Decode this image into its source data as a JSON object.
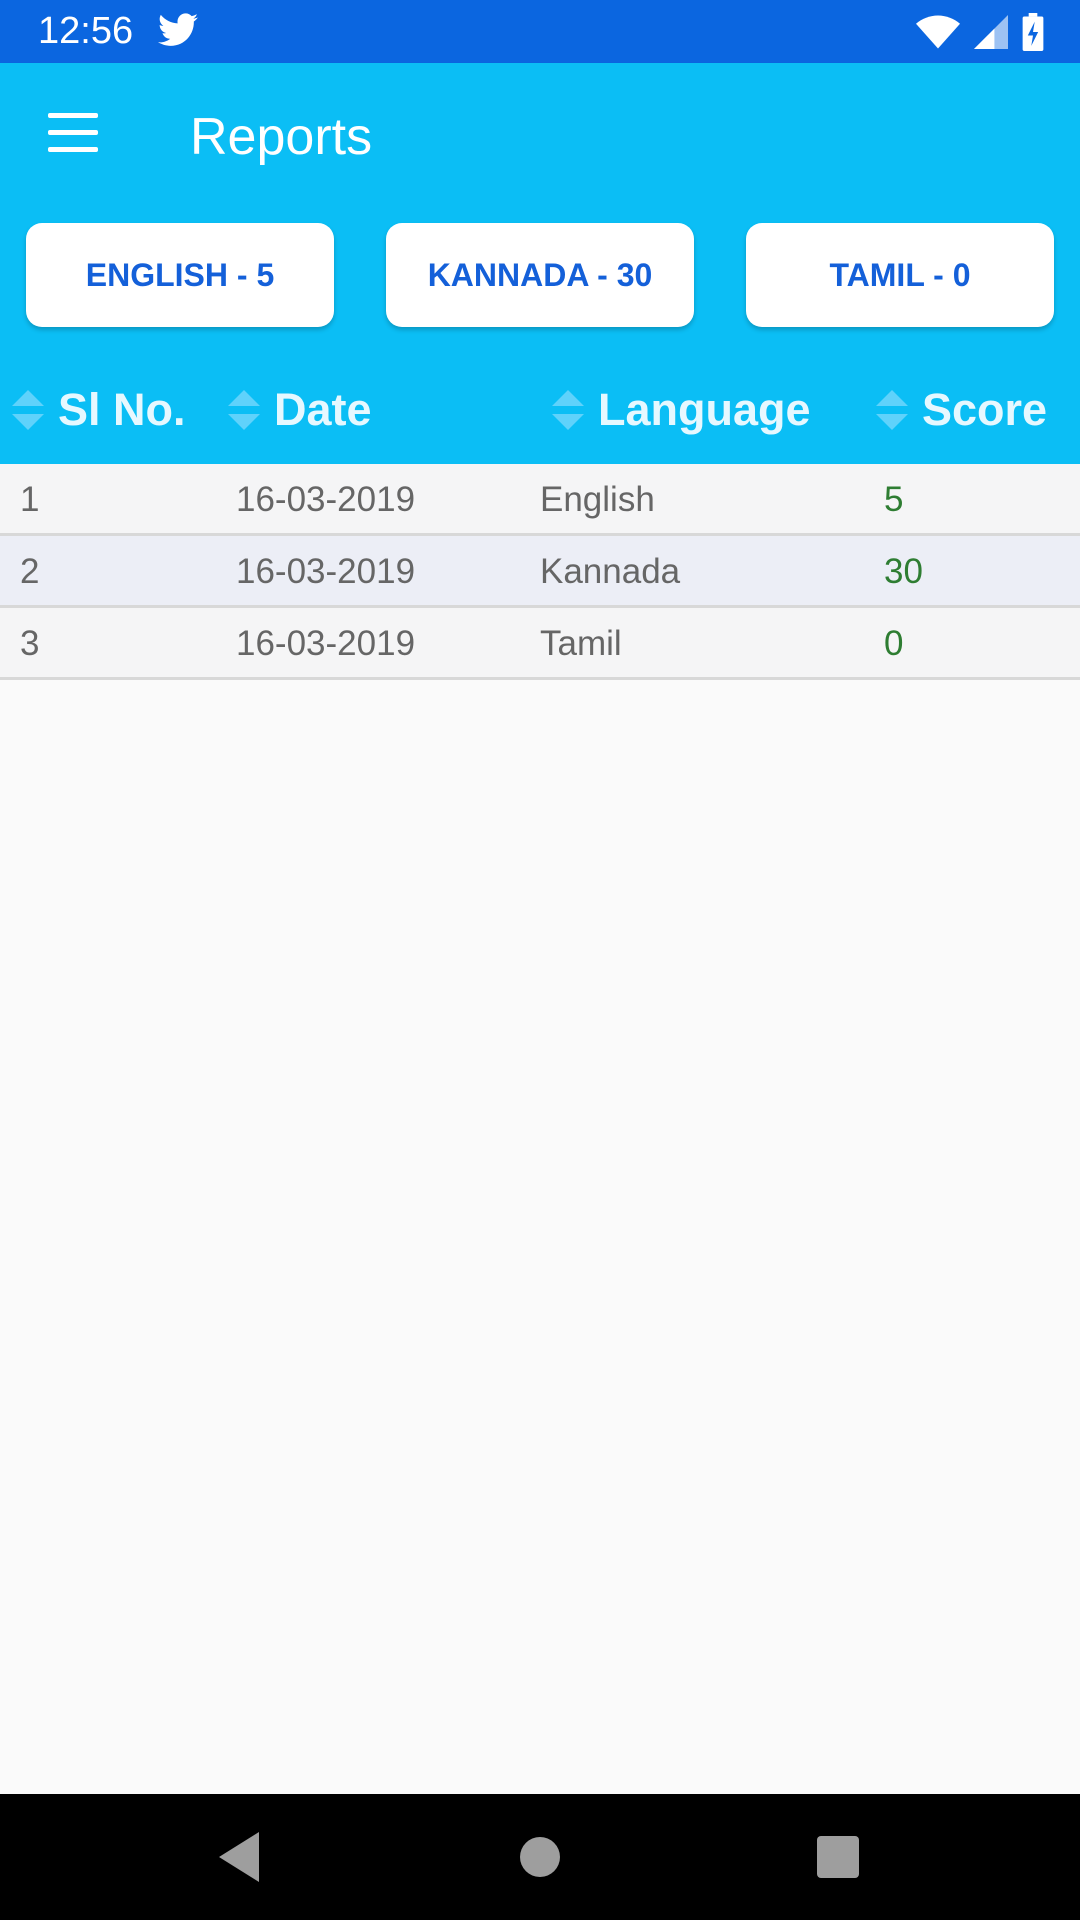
{
  "status_bar": {
    "time": "12:56",
    "icons": [
      "twitter-icon",
      "wifi-icon",
      "signal-icon",
      "battery-charging-icon"
    ],
    "color": "#0b66e0"
  },
  "app_bar": {
    "title": "Reports",
    "menu_icon": "hamburger-menu-icon",
    "color": "#0bbef5"
  },
  "language_buttons": [
    {
      "label": "ENGLISH - 5"
    },
    {
      "label": "KANNADA - 30"
    },
    {
      "label": "TAMIL - 0"
    }
  ],
  "table": {
    "headers": [
      "Sl No.",
      "Date",
      "Language",
      "Score"
    ],
    "sort_icon": "sort-icon",
    "rows": [
      {
        "sl": "1",
        "date": "16-03-2019",
        "language": "English",
        "score": "5"
      },
      {
        "sl": "2",
        "date": "16-03-2019",
        "language": "Kannada",
        "score": "30"
      },
      {
        "sl": "3",
        "date": "16-03-2019",
        "language": "Tamil",
        "score": "0"
      }
    ],
    "score_color": "#2e7d32"
  },
  "nav_bar": {
    "buttons": [
      "back-icon",
      "home-icon",
      "recents-icon"
    ]
  }
}
